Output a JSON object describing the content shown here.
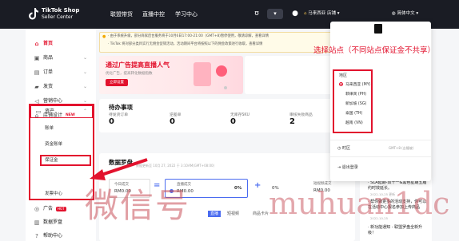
{
  "topbar": {
    "logo_line1": "TikTok Shop",
    "logo_line2": "Seller Center",
    "nav": [
      "联盟带货",
      "直播中控",
      "学习中心"
    ],
    "msg_count": "⋯",
    "store": "马来西亚 店铺",
    "lang": "简体中文"
  },
  "sidebar": {
    "items": [
      {
        "label": "首页",
        "icon": "home-icon",
        "active": true
      },
      {
        "label": "商品",
        "icon": "box-icon"
      },
      {
        "label": "订单",
        "icon": "order-icon"
      },
      {
        "label": "发货",
        "icon": "truck-icon"
      },
      {
        "label": "营销中心",
        "icon": "megaphone-icon"
      },
      {
        "label": "店铺设计",
        "icon": "store-icon",
        "badge": "NEW"
      },
      {
        "label": "资产",
        "icon": "wallet-icon"
      },
      {
        "label": "广告",
        "icon": "ad-icon",
        "badge": "HOT"
      },
      {
        "label": "数据罗盘",
        "icon": "chart-icon"
      },
      {
        "label": "帮助中心",
        "icon": "help-icon"
      }
    ],
    "sub": [
      "账单",
      "资金账单",
      "保证金",
      "发票中心"
    ]
  },
  "notice": {
    "line1": "· 由于系统升级，部分商家后台服务将于10月6日17:00-21:00（GMT+8)暂停使用，敬请谅解，查看详情",
    "line2": "· TikTok 将对部分类目实行无佣金促销活动，活动期间平台将按照以下的佣金政策进行收取，查看详情",
    "link": "查看详情"
  },
  "banner": {
    "title": "通过广告提高直播人气",
    "sub": "优化广告，提高转化数据指数",
    "button": "立即设置"
  },
  "todo": {
    "title": "待办事项",
    "cols": [
      {
        "label": "待发货订单",
        "value": "0"
      },
      {
        "label": "逆差单",
        "value": "0"
      },
      {
        "label": "无库存SKU",
        "value": "0"
      },
      {
        "label": "审核失败商品",
        "value": "2"
      }
    ]
  },
  "dashboard": {
    "title": "数据罗盘",
    "subtitle": "数据更新至 10月 27, 2022 于 3:10AM(GMT+08:00)",
    "today_sales_label": "今日成交",
    "today_sales": "RM0.00",
    "live_label": "直播成交",
    "live_value": "RM0.00",
    "live_pct": "0%",
    "plus_pct": "0%",
    "short_video_label": "短视频成交",
    "short_video_value": "RM0.00",
    "tabs": [
      "直播",
      "短视频",
      "商品卡片"
    ]
  },
  "dropdown": {
    "region_label": "地区",
    "regions": [
      "马来西亚 (MY)",
      "菲律宾 (PH)",
      "新加坡 (SG)",
      "泰国 (TH)",
      "越南 (VN)"
    ],
    "timezone_label": "时区",
    "timezone_value": "GMT+8 (吉隆坡)",
    "logout": "退出登录"
  },
  "annotation": "选择站点（不同站点保证金不共享）",
  "news": [
    {
      "title": "· SLA延期-双十一&黑色星期五履约时效延长。",
      "date": "2022-10-25 更新"
    },
    {
      "title": "· 帮你做更多的活动支持，你可以在活动中心报名参加上传商品",
      "date": "2022-10-25"
    },
    {
      "title": "· 新功能通知 - 联盟罗盘全新升级！",
      "date": ""
    }
  ],
  "watermark": [
    "微信号",
    "muhuan1dc"
  ],
  "colors": {
    "brand": "#e2122d",
    "topbar": "#1a1c24",
    "accent": "#4a6bf0"
  }
}
